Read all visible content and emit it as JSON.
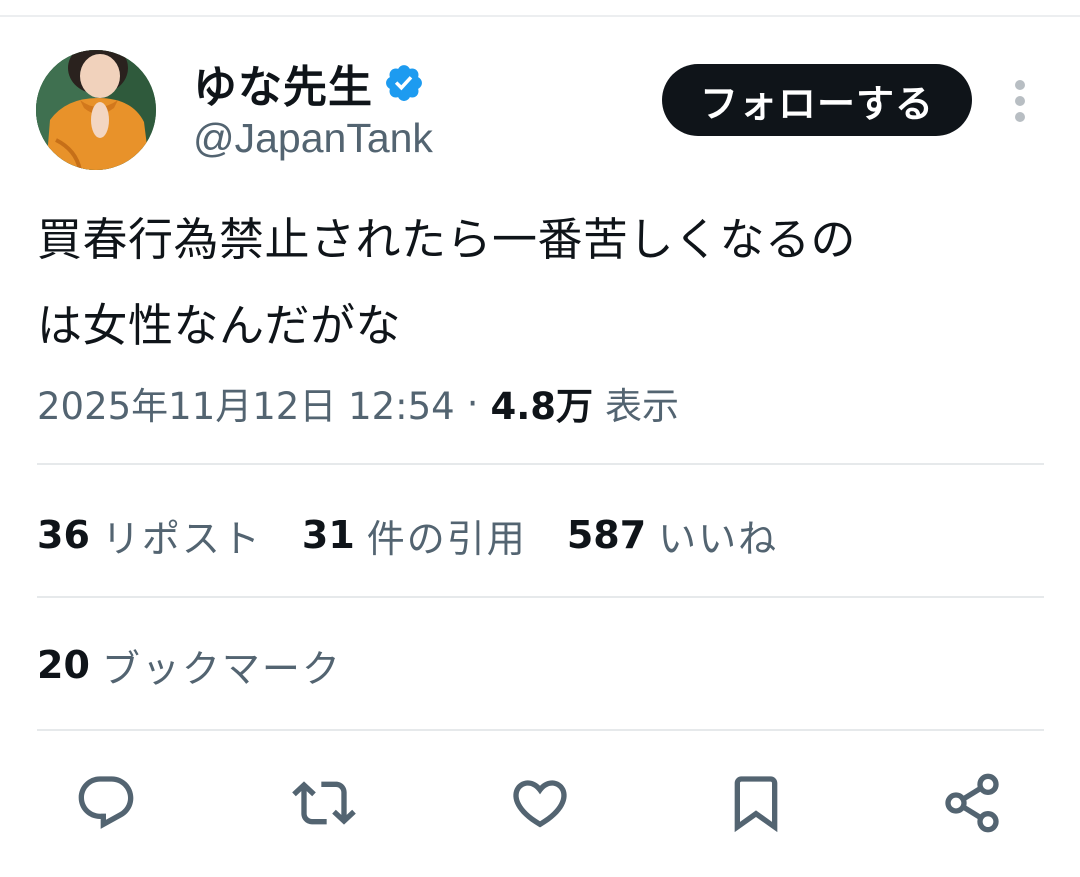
{
  "author": {
    "display_name": "ゆな先生",
    "handle": "@JapanTank",
    "verified_icon": "verified-badge-icon",
    "avatar": "avatar-photo"
  },
  "follow_button": {
    "label": "フォローする"
  },
  "more_icon": "more-vertical-icon",
  "tweet": {
    "text_lines": [
      "買春行為禁止されたら一番苦しくなるの",
      "は女性なんだがな"
    ]
  },
  "meta": {
    "timestamp": "2025年11月12日 12:54",
    "separator": "·",
    "views_count": "4.8万",
    "views_label": "表示"
  },
  "stats": {
    "reposts": {
      "count": "36",
      "label": "リポスト"
    },
    "quotes": {
      "count": "31",
      "label": "件の引用"
    },
    "likes": {
      "count": "587",
      "label": "いいね"
    },
    "bookmarks": {
      "count": "20",
      "label": "ブックマーク"
    }
  },
  "actions": [
    {
      "icon": "reply-icon"
    },
    {
      "icon": "repost-icon"
    },
    {
      "icon": "like-icon"
    },
    {
      "icon": "bookmark-icon"
    },
    {
      "icon": "share-icon"
    }
  ],
  "colors": {
    "text_primary": "#0f1419",
    "text_secondary": "#536471",
    "verified_blue": "#1d9bf0",
    "divider": "#e6e9eb",
    "button_bg": "#0f1419",
    "avatar_sweater": "#e8922a"
  }
}
